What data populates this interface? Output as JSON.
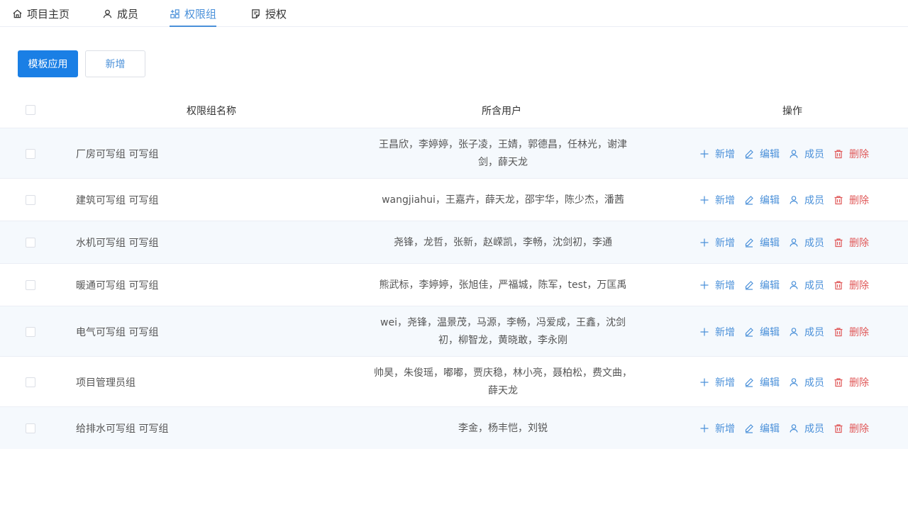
{
  "tabs": [
    {
      "label": "项目主页",
      "icon": "home-icon"
    },
    {
      "label": "成员",
      "icon": "user-icon"
    },
    {
      "label": "权限组",
      "icon": "grid-icon",
      "active": true
    },
    {
      "label": "授权",
      "icon": "document-check-icon"
    }
  ],
  "toolbar": {
    "template_label": "模板应用",
    "add_label": "新增"
  },
  "table": {
    "columns": [
      "权限组名称",
      "所含用户",
      "操作"
    ],
    "actions": {
      "add": "新增",
      "edit": "编辑",
      "members": "成员",
      "delete": "删除"
    },
    "rows": [
      {
        "name": "厂房可写组 可写组",
        "users": [
          "王昌欣，李婷婷，张子凌，王婧，郭德昌，任林光，谢津",
          "剑，薛天龙"
        ]
      },
      {
        "name": "建筑可写组 可写组",
        "users": [
          "wangjiahui，王嘉卉，薛天龙，邵宇华，陈少杰，潘茜"
        ]
      },
      {
        "name": "水机可写组 可写组",
        "users": [
          "尧锋，龙哲，张新，赵嵘凯，李畅，沈剑初，李通"
        ]
      },
      {
        "name": "暖通可写组 可写组",
        "users": [
          "熊武标，李婷婷，张旭佳，严福城，陈军，test，万匡禹"
        ]
      },
      {
        "name": "电气可写组 可写组",
        "users": [
          "wei，尧锋，温景茂，马源，李畅，冯爱成，王鑫，沈剑",
          "初，柳智龙，黄晓敢，李永刚"
        ]
      },
      {
        "name": "项目管理员组",
        "users": [
          "帅昊，朱俊瑶，嘟嘟，贾庆稳，林小亮，聂柏松，费文曲，",
          "薛天龙"
        ]
      },
      {
        "name": "给排水可写组 可写组",
        "users": [
          "李金，杨丰恺，刘锐"
        ]
      }
    ]
  },
  "colors": {
    "primary": "#1a7fe5",
    "link": "#4a90d9",
    "danger": "#e05858",
    "stripe": "#f5f9fd"
  }
}
